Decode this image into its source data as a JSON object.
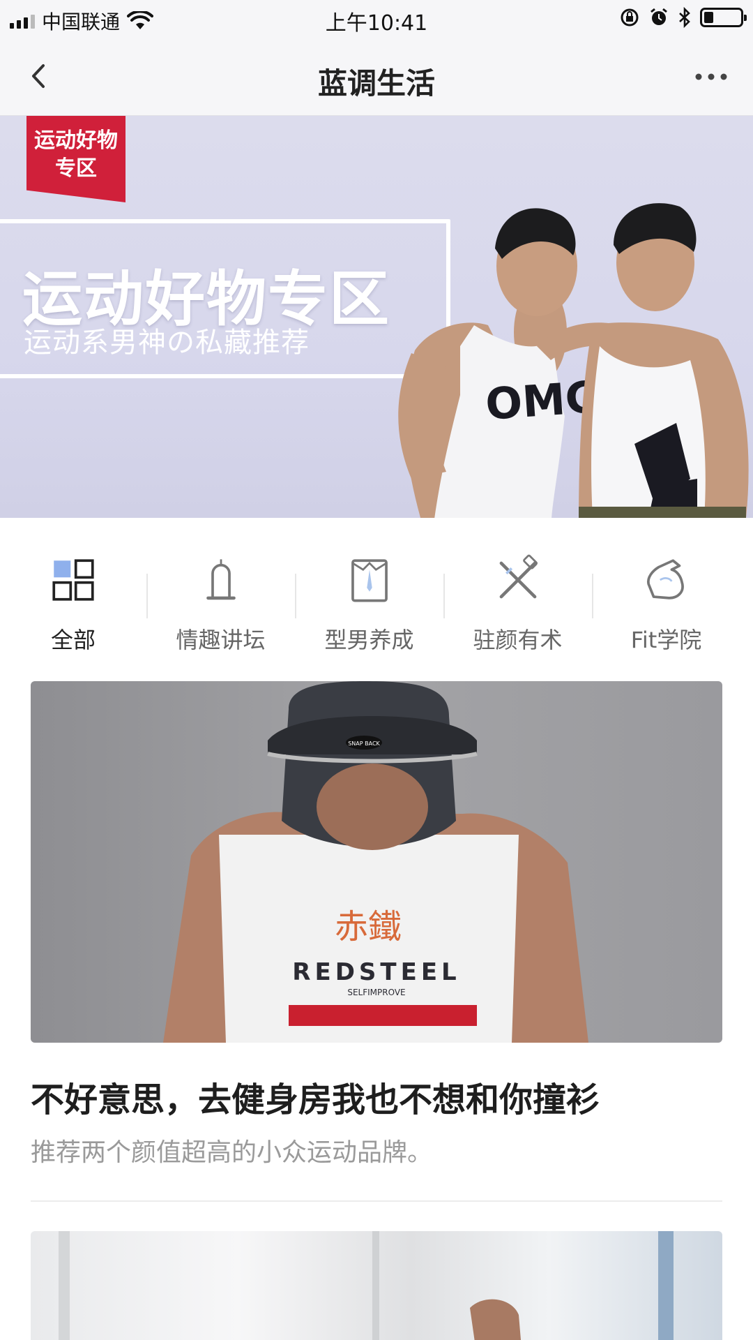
{
  "status_bar": {
    "carrier": "中国联通",
    "time": "上午10:41",
    "battery_level": 0.25
  },
  "nav": {
    "title": "蓝调生活",
    "back_icon": "chevron-left-icon",
    "more_icon": "more-horizontal-icon"
  },
  "banner": {
    "ribbon_text": "运动好物专区",
    "title": "运动好物专区",
    "subtitle": "运动系男神の私藏推荐",
    "shirt_text": "OMG",
    "colors": {
      "ribbon": "#d0203a",
      "background": "#d7d7ec"
    }
  },
  "categories": [
    {
      "label": "全部",
      "icon": "grid-icon",
      "active": true
    },
    {
      "label": "情趣讲坛",
      "icon": "condom-icon",
      "active": false
    },
    {
      "label": "型男养成",
      "icon": "shirt-icon",
      "active": false
    },
    {
      "label": "驻颜有术",
      "icon": "razor-icon",
      "active": false
    },
    {
      "label": "Fit学院",
      "icon": "bicep-icon",
      "active": false
    }
  ],
  "articles": [
    {
      "title": "不好意思，去健身房我也不想和你撞衫",
      "summary": "推荐两个颜值超高的小众运动品牌。",
      "image_text": {
        "logo_cn": "赤鐵",
        "brand": "REDSTEEL",
        "tagline": "SELFIMPROVE",
        "cap": "SNAP BACK"
      }
    }
  ],
  "colors": {
    "accent_blue": "#8fb0ec",
    "icon_gray": "#777777",
    "text_muted": "#9a9a9a"
  }
}
